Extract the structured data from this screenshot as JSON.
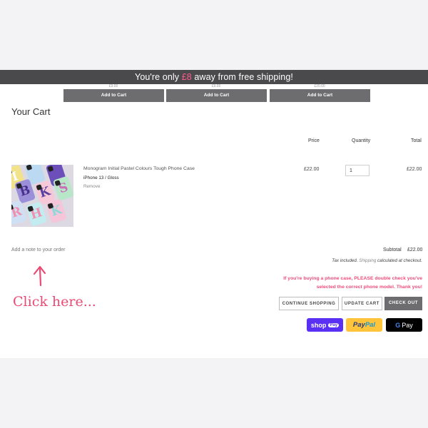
{
  "banner": {
    "prefix": "You're only ",
    "amount": "£8",
    "suffix": " away from free shipping!"
  },
  "recommended": {
    "button_label": "Add to Cart",
    "peek_prices": [
      "£9.00",
      "£9.00",
      "£20.00"
    ]
  },
  "cart": {
    "title": "Your Cart",
    "columns": {
      "price": "Price",
      "quantity": "Quantity",
      "total": "Total"
    },
    "item": {
      "thumbnail_letters": [
        "I",
        "B",
        "S",
        "J",
        "R",
        "K",
        "H",
        "R",
        "K"
      ],
      "name": "Monogram Initial Pastel Colours Tough Phone Case",
      "variant": "iPhone 13 / Gloss",
      "remove_label": "Remove",
      "price": "£22.00",
      "quantity": "1",
      "total": "£22.00"
    },
    "note_link": "Add a note to your order",
    "subtotal_label": "Subtotal",
    "subtotal_value": "£22.00",
    "tax_prefix": "Tax included. ",
    "tax_shipping_link": "Shipping",
    "tax_suffix": " calculated at checkout.",
    "warning": "If you're buying a phone case, PLEASE double check you've selected the correct phone model. Thank you!",
    "buttons": {
      "continue": "CONTINUE SHOPPING",
      "update": "UPDATE CART",
      "checkout": "CHECK OUT"
    },
    "payments": {
      "shop_pay": "shop",
      "shop_pay_badge": "Pay",
      "paypal_a": "Pay",
      "paypal_b": "Pal",
      "gpay_g": "G",
      "gpay_text": "Pay"
    }
  },
  "annotation": {
    "text": "Click here..."
  },
  "colors": {
    "accent": "#f14b7a",
    "banner_bg": "#4a4a4d",
    "button_gray": "#6d6d6f",
    "shop_pay": "#5a31f4",
    "paypal": "#ffc439"
  }
}
